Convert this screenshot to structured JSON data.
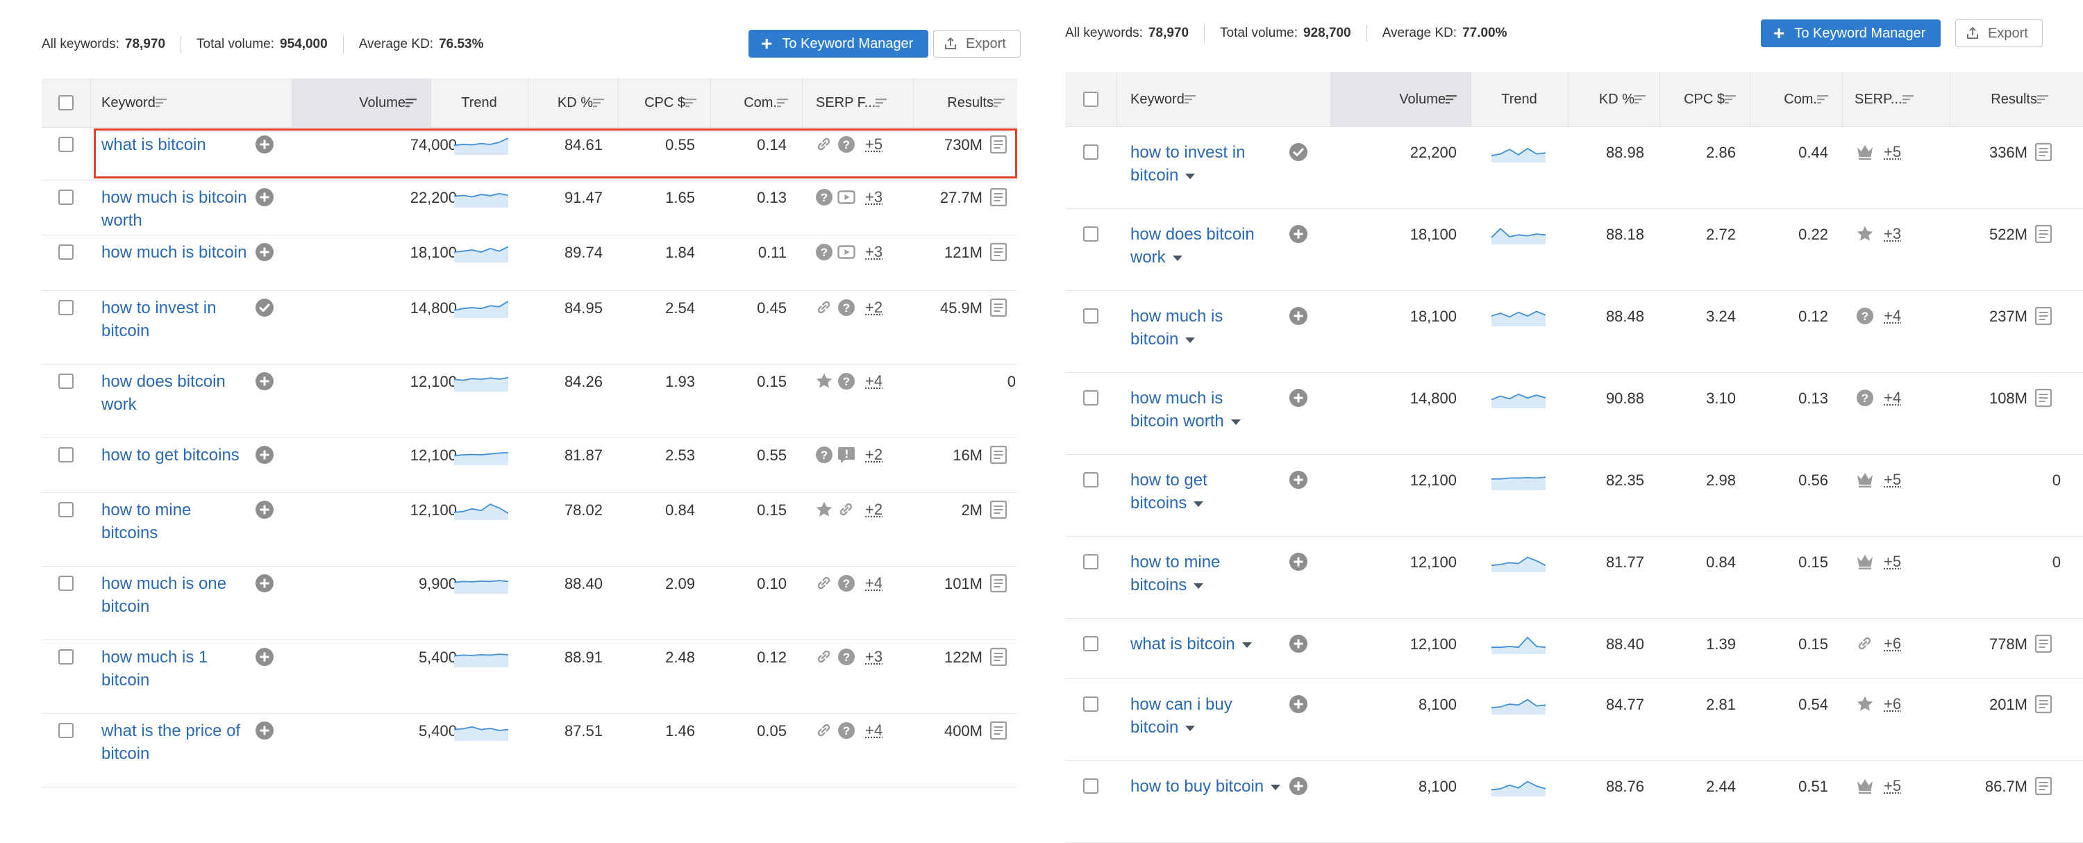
{
  "left": {
    "summary": {
      "all_keywords_label": "All keywords:",
      "all_keywords_value": "78,970",
      "total_volume_label": "Total volume:",
      "total_volume_value": "954,000",
      "avg_kd_label": "Average KD:",
      "avg_kd_value": "76.53%"
    },
    "buttons": {
      "keyword_manager": "To Keyword Manager",
      "export": "Export"
    },
    "columns": {
      "keyword": "Keyword",
      "volume": "Volume",
      "trend": "Trend",
      "kd": "KD %",
      "cpc": "CPC $",
      "com": "Com.",
      "serp": "SERP F...",
      "results": "Results"
    },
    "rows": [
      {
        "keyword": "what is bitcoin",
        "kw_lines": [
          "what is bitcoin"
        ],
        "action": "plus",
        "volume": "74,000",
        "trend": [
          0.45,
          0.5,
          0.48,
          0.55,
          0.5,
          0.62,
          0.85
        ],
        "kd": "84.61",
        "cpc": "0.55",
        "com": "0.14",
        "serp_icons": [
          "link-icon",
          "question-icon"
        ],
        "serp_more": "+5",
        "results": "730M",
        "results_doc": true,
        "highlighted": true
      },
      {
        "keyword": "how much is bitcoin worth",
        "kw_lines": [
          "how much is bitcoin",
          "worth"
        ],
        "action": "plus",
        "volume": "22,200",
        "trend": [
          0.55,
          0.6,
          0.52,
          0.65,
          0.58,
          0.7,
          0.6
        ],
        "kd": "91.47",
        "cpc": "1.65",
        "com": "0.13",
        "serp_icons": [
          "question-icon",
          "video-icon"
        ],
        "serp_more": "+3",
        "results": "27.7M",
        "results_doc": true
      },
      {
        "keyword": "how much is bitcoin",
        "kw_lines": [
          "how much is bitcoin"
        ],
        "action": "plus",
        "volume": "18,100",
        "trend": [
          0.5,
          0.55,
          0.62,
          0.5,
          0.7,
          0.55,
          0.8
        ],
        "kd": "89.74",
        "cpc": "1.84",
        "com": "0.11",
        "serp_icons": [
          "question-icon",
          "video-icon"
        ],
        "serp_more": "+3",
        "results": "121M",
        "results_doc": true
      },
      {
        "keyword": "how to invest in bitcoin",
        "kw_lines": [
          "how to invest in",
          "bitcoin"
        ],
        "action": "check",
        "volume": "14,800",
        "trend": [
          0.35,
          0.45,
          0.5,
          0.45,
          0.6,
          0.55,
          0.85
        ],
        "kd": "84.95",
        "cpc": "2.54",
        "com": "0.45",
        "serp_icons": [
          "link-icon",
          "question-icon"
        ],
        "serp_more": "+2",
        "results": "45.9M",
        "results_doc": true
      },
      {
        "keyword": "how does bitcoin work",
        "kw_lines": [
          "how does bitcoin",
          "work"
        ],
        "action": "plus",
        "volume": "12,100",
        "trend": [
          0.6,
          0.55,
          0.65,
          0.6,
          0.68,
          0.62,
          0.7
        ],
        "kd": "84.26",
        "cpc": "1.93",
        "com": "0.15",
        "serp_icons": [
          "star-icon",
          "question-icon"
        ],
        "serp_more": "+4",
        "results": "0",
        "results_doc": false
      },
      {
        "keyword": "how to get bitcoins",
        "kw_lines": [
          "how to get bitcoins"
        ],
        "action": "plus",
        "volume": "12,100",
        "trend": [
          0.45,
          0.5,
          0.52,
          0.5,
          0.55,
          0.6,
          0.62
        ],
        "kd": "81.87",
        "cpc": "2.53",
        "com": "0.55",
        "serp_icons": [
          "question-icon",
          "review-icon"
        ],
        "serp_more": "+2",
        "results": "16M",
        "results_doc": true
      },
      {
        "keyword": "how to mine bitcoins",
        "kw_lines": [
          "how to mine",
          "bitcoins"
        ],
        "action": "plus",
        "volume": "12,100",
        "trend": [
          0.35,
          0.4,
          0.55,
          0.45,
          0.8,
          0.6,
          0.3
        ],
        "kd": "78.02",
        "cpc": "0.84",
        "com": "0.15",
        "serp_icons": [
          "star-icon",
          "link-icon"
        ],
        "serp_more": "+2",
        "results": "2M",
        "results_doc": true
      },
      {
        "keyword": "how much is one bitcoin",
        "kw_lines": [
          "how much is one",
          "bitcoin"
        ],
        "action": "plus",
        "volume": "9,900",
        "trend": [
          0.55,
          0.6,
          0.58,
          0.62,
          0.6,
          0.65,
          0.6
        ],
        "kd": "88.40",
        "cpc": "2.09",
        "com": "0.10",
        "serp_icons": [
          "link-icon",
          "question-icon"
        ],
        "serp_more": "+4",
        "results": "101M",
        "results_doc": true
      },
      {
        "keyword": "how much is 1 bitcoin",
        "kw_lines": [
          "how much is 1",
          "bitcoin"
        ],
        "action": "plus",
        "volume": "5,400",
        "trend": [
          0.55,
          0.6,
          0.58,
          0.62,
          0.6,
          0.65,
          0.62
        ],
        "kd": "88.91",
        "cpc": "2.48",
        "com": "0.12",
        "serp_icons": [
          "link-icon",
          "question-icon"
        ],
        "serp_more": "+3",
        "results": "122M",
        "results_doc": true
      },
      {
        "keyword": "what is the price of bitcoin",
        "kw_lines": [
          "what is the price of",
          "bitcoin"
        ],
        "action": "plus",
        "volume": "5,400",
        "trend": [
          0.55,
          0.6,
          0.7,
          0.55,
          0.62,
          0.5,
          0.55
        ],
        "kd": "87.51",
        "cpc": "1.46",
        "com": "0.05",
        "serp_icons": [
          "link-icon",
          "question-icon"
        ],
        "serp_more": "+4",
        "results": "400M",
        "results_doc": true
      }
    ]
  },
  "right": {
    "summary": {
      "all_keywords_label": "All keywords:",
      "all_keywords_value": "78,970",
      "total_volume_label": "Total volume:",
      "total_volume_value": "928,700",
      "avg_kd_label": "Average KD:",
      "avg_kd_value": "77.00%"
    },
    "buttons": {
      "keyword_manager": "To Keyword Manager",
      "export": "Export"
    },
    "columns": {
      "keyword": "Keyword",
      "volume": "Volume",
      "trend": "Trend",
      "kd": "KD %",
      "cpc": "CPC $",
      "com": "Com.",
      "serp": "SERP...",
      "results": "Results"
    },
    "rows": [
      {
        "keyword": "how to invest in bitcoin",
        "kw_lines": [
          "how to invest in",
          "bitcoin"
        ],
        "action": "check",
        "volume": "22,200",
        "trend": [
          0.3,
          0.4,
          0.65,
          0.35,
          0.7,
          0.4,
          0.45
        ],
        "kd": "88.98",
        "cpc": "2.86",
        "com": "0.44",
        "serp_icons": [
          "crown-icon"
        ],
        "serp_more": "+5",
        "results": "336M",
        "results_doc": true
      },
      {
        "keyword": "how does bitcoin work",
        "kw_lines": [
          "how does bitcoin",
          "work"
        ],
        "action": "plus",
        "volume": "18,100",
        "trend": [
          0.3,
          0.8,
          0.35,
          0.45,
          0.4,
          0.5,
          0.45
        ],
        "kd": "88.18",
        "cpc": "2.72",
        "com": "0.22",
        "serp_icons": [
          "star-icon"
        ],
        "serp_more": "+3",
        "results": "522M",
        "results_doc": true
      },
      {
        "keyword": "how much is bitcoin",
        "kw_lines": [
          "how much is",
          "bitcoin"
        ],
        "action": "plus",
        "volume": "18,100",
        "trend": [
          0.5,
          0.65,
          0.45,
          0.7,
          0.5,
          0.75,
          0.55
        ],
        "kd": "88.48",
        "cpc": "3.24",
        "com": "0.12",
        "serp_icons": [
          "question-icon"
        ],
        "serp_more": "+4",
        "results": "237M",
        "results_doc": true
      },
      {
        "keyword": "how much is bitcoin worth",
        "kw_lines": [
          "how much is",
          "bitcoin worth"
        ],
        "action": "plus",
        "volume": "14,800",
        "trend": [
          0.4,
          0.6,
          0.45,
          0.7,
          0.5,
          0.65,
          0.5
        ],
        "kd": "90.88",
        "cpc": "3.10",
        "com": "0.13",
        "serp_icons": [
          "question-icon"
        ],
        "serp_more": "+4",
        "results": "108M",
        "results_doc": true
      },
      {
        "keyword": "how to get bitcoins",
        "kw_lines": [
          "how to get",
          "bitcoins"
        ],
        "action": "plus",
        "volume": "12,100",
        "trend": [
          0.55,
          0.55,
          0.6,
          0.6,
          0.62,
          0.6,
          0.65
        ],
        "kd": "82.35",
        "cpc": "2.98",
        "com": "0.56",
        "serp_icons": [
          "crown-icon"
        ],
        "serp_more": "+5",
        "results": "0",
        "results_doc": false
      },
      {
        "keyword": "how to mine bitcoins",
        "kw_lines": [
          "how to mine",
          "bitcoins"
        ],
        "action": "plus",
        "volume": "12,100",
        "trend": [
          0.3,
          0.35,
          0.45,
          0.4,
          0.75,
          0.55,
          0.3
        ],
        "kd": "81.77",
        "cpc": "0.84",
        "com": "0.15",
        "serp_icons": [
          "crown-icon"
        ],
        "serp_more": "+5",
        "results": "0",
        "results_doc": false
      },
      {
        "keyword": "what is bitcoin",
        "kw_lines": [
          "what is bitcoin"
        ],
        "action": "plus",
        "volume": "12,100",
        "trend": [
          0.3,
          0.3,
          0.35,
          0.3,
          0.85,
          0.35,
          0.3
        ],
        "kd": "88.40",
        "cpc": "1.39",
        "com": "0.15",
        "serp_icons": [
          "link-icon"
        ],
        "serp_more": "+6",
        "results": "778M",
        "results_doc": true
      },
      {
        "keyword": "how can i buy bitcoin",
        "kw_lines": [
          "how can i buy",
          "bitcoin"
        ],
        "action": "plus",
        "volume": "8,100",
        "trend": [
          0.3,
          0.35,
          0.5,
          0.45,
          0.75,
          0.4,
          0.45
        ],
        "kd": "84.77",
        "cpc": "2.81",
        "com": "0.54",
        "serp_icons": [
          "star-icon"
        ],
        "serp_more": "+6",
        "results": "201M",
        "results_doc": true
      },
      {
        "keyword": "how to buy bitcoin",
        "kw_lines": [
          "how to buy bitcoin"
        ],
        "action": "plus",
        "volume": "8,100",
        "trend": [
          0.3,
          0.35,
          0.55,
          0.4,
          0.75,
          0.5,
          0.35
        ],
        "kd": "88.76",
        "cpc": "2.44",
        "com": "0.51",
        "serp_icons": [
          "crown-icon"
        ],
        "serp_more": "+5",
        "results": "86.7M",
        "results_doc": true
      }
    ]
  },
  "colors": {
    "link": "#2b69b0",
    "primary_button": "#2d7cd0",
    "highlight_border": "#e0412b",
    "trend_line": "#3f8fd8",
    "trend_fill": "#d9e9f8",
    "icon_gray": "#9b9b9b"
  }
}
